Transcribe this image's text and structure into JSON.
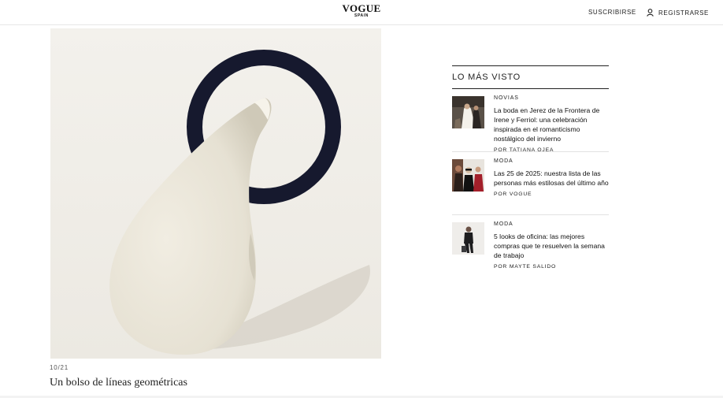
{
  "header": {
    "logo_main": "VOGUE",
    "logo_sub": "SPAIN",
    "subscribe_label": "SUSCRIBIRSE",
    "register_label": "REGISTRARSE",
    "register_icon": "user-icon"
  },
  "gallery": {
    "counter": "10/21",
    "caption": "Un bolso de líneas geométricas",
    "image_subject": "cream bag with navy ring handle"
  },
  "sidebar": {
    "title": "LO MÁS VISTO",
    "stories": [
      {
        "category": "NOVIAS",
        "title": "La boda en Jerez de la Frontera de Irene y Ferriol: una celebración inspirada en el romanticismo nostálgico del invierno",
        "author": "POR TATIANA OJEA"
      },
      {
        "category": "MODA",
        "title": "Las 25 de 2025: nuestra lista de las personas más estilosas del último año",
        "author": "POR VOGUE"
      },
      {
        "category": "MODA",
        "title": "5 looks de oficina: las mejores compras que te resuelven la semana de trabajo",
        "author": "POR MAYTE SALIDO"
      }
    ]
  },
  "colors": {
    "bag_cream": "#ece8dc",
    "ring_navy": "#16192e",
    "background": "#f1efe9"
  }
}
